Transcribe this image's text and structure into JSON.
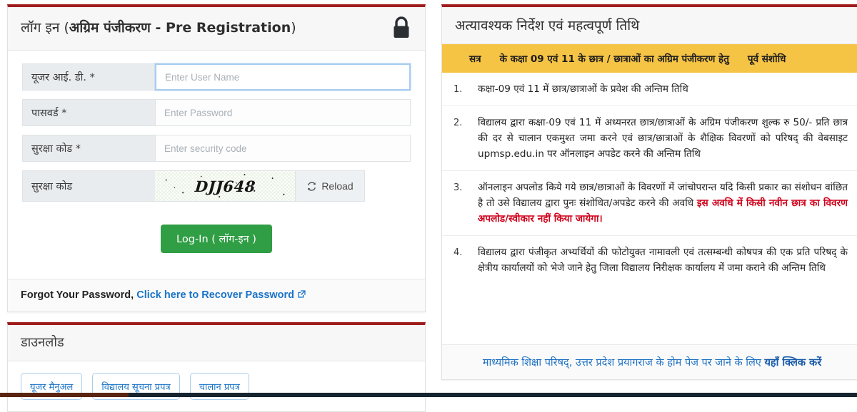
{
  "colors": {
    "accent_red": "#9f1c1c",
    "header_yellow": "#f6c445",
    "login_green": "#2f9e44",
    "link_blue": "#1a73c8",
    "alert_red": "#d0021b"
  },
  "login": {
    "title_plain": "लॉग इन (",
    "title_bold": "अग्रिम पंजीकरण - Pre Registration",
    "title_close": ")",
    "lock_icon": "lock-icon",
    "fields": [
      {
        "label": "यूजर आई. डी. *",
        "placeholder": "Enter User Name",
        "value": "",
        "name": "username"
      },
      {
        "label": "पासवर्ड *",
        "placeholder": "Enter Password",
        "value": "",
        "name": "password"
      },
      {
        "label": "सुरक्षा कोड *",
        "placeholder": "Enter security code",
        "value": "",
        "name": "security-code"
      }
    ],
    "captcha": {
      "label": "सुरक्षा कोड",
      "code": "DJJ648",
      "reload_label": "Reload",
      "reload_icon": "refresh-icon"
    },
    "submit_label": "Log-In ( लॉग-इन )",
    "footer_prefix": "Forgot Your Password,",
    "footer_link": "Click here to Recover Password",
    "footer_link_icon": "external-link-icon"
  },
  "download": {
    "title": "डाउनलोड",
    "buttons": [
      {
        "label": "यूजर मैनुअल"
      },
      {
        "label": "विद्यालय सूचना प्रपत्र"
      },
      {
        "label": "चालान प्रपत्र"
      }
    ]
  },
  "notice": {
    "title": "अत्यावश्यक निर्देश एवं महत्वपूर्ण तिथि",
    "table_header": {
      "col_session": "सत्र",
      "col_main": "के कक्षा 09 एवं 11 के छात्र / छात्राओं का अग्रिम पंजीकरण हेतु",
      "col_revised": "पूर्व संशोधि"
    },
    "items": [
      {
        "num": "1.",
        "text": "कक्षा-09 एवं 11 में छात्र/छात्राओं के प्रवेश की अन्तिम तिथि",
        "highlight": ""
      },
      {
        "num": "2.",
        "text": "विद्यालय द्वारा कक्षा-09 एवं 11 में अध्यनरत छात्र/छात्राओं के अग्रिम पंजीकरण शुल्क रु 50/- प्रति छात्र की दर से चालान एकमुश्त जमा करने एवं छात्र/छात्राओं के शैक्षिक विवरणों को परिषद् की वेबसाइट upmsp.edu.in पर ऑनलाइन अपडेट करने की अन्तिम तिथि",
        "highlight": ""
      },
      {
        "num": "3.",
        "text": "ऑनलाइन अपलोड किये गये छात्र/छात्राओं के विवरणों में जांचोपरान्त यदि किसी प्रकार का संशोधन वांछित है तो उसे विद्यालय द्वारा पुनः संशोधित/अपडेट करने की अवधि ",
        "highlight": "इस अवधि में किसी नवीन छात्र का विवरण अपलोड/स्वीकार नहीं किया जायेगा।"
      },
      {
        "num": "4.",
        "text": "विद्यालय द्वारा पंजीकृत अभ्यर्थियों की फोटोयुक्त नामावली एवं तत्सम्बन्धी कोषपत्र की एक प्रति परिषद् के क्षेत्रीय कार्यालयों को भेजे जाने हेतु जिला विद्यालय निरीक्षक कार्यालय में जमा कराने की अन्तिम तिथि",
        "highlight": ""
      }
    ],
    "footer_text": "माध्यमिक शिक्षा परिषद्, उत्तर प्रदेश प्रयागराज के होम पेज पर जाने के लिए ",
    "footer_link": "यहाँ क्लिक करें"
  }
}
